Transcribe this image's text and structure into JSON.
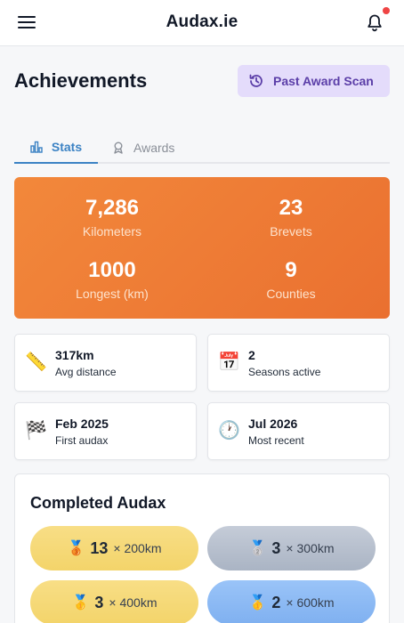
{
  "header": {
    "title": "Audax.ie"
  },
  "page": {
    "title": "Achievements",
    "scan_button": "Past Award Scan"
  },
  "tabs": [
    {
      "label": "Stats"
    },
    {
      "label": "Awards"
    }
  ],
  "hero": {
    "stats": [
      {
        "value": "7,286",
        "caption": "Kilometers"
      },
      {
        "value": "23",
        "caption": "Brevets"
      },
      {
        "value": "1000",
        "caption": "Longest (km)"
      },
      {
        "value": "9",
        "caption": "Counties"
      }
    ],
    "gradient_from": "#f2883b",
    "gradient_to": "#ea7030"
  },
  "cards": [
    {
      "icon": "ruler-icon",
      "value": "317km",
      "label": "Avg distance"
    },
    {
      "icon": "calendar-icon",
      "value": "2",
      "label": "Seasons active"
    },
    {
      "icon": "chequered-flag-icon",
      "value": "Feb 2025",
      "label": "First audax"
    },
    {
      "icon": "clock-icon",
      "value": "Jul 2026",
      "label": "Most recent"
    }
  ],
  "completed": {
    "title": "Completed Audax",
    "items": [
      {
        "icon": "bronze-medal-icon",
        "count": "13",
        "label": "× 200km"
      },
      {
        "icon": "silver-medal-icon",
        "count": "3",
        "label": "× 300km"
      },
      {
        "icon": "gold-medal-icon",
        "count": "3",
        "label": "× 400km"
      },
      {
        "icon": "gold-medal-icon",
        "count": "2",
        "label": "× 600km"
      }
    ]
  },
  "colors": {
    "accent": "#3b82c4",
    "scan_bg": "#e4dcfb",
    "scan_text": "#5b3ea8",
    "notification": "#ef4444"
  }
}
